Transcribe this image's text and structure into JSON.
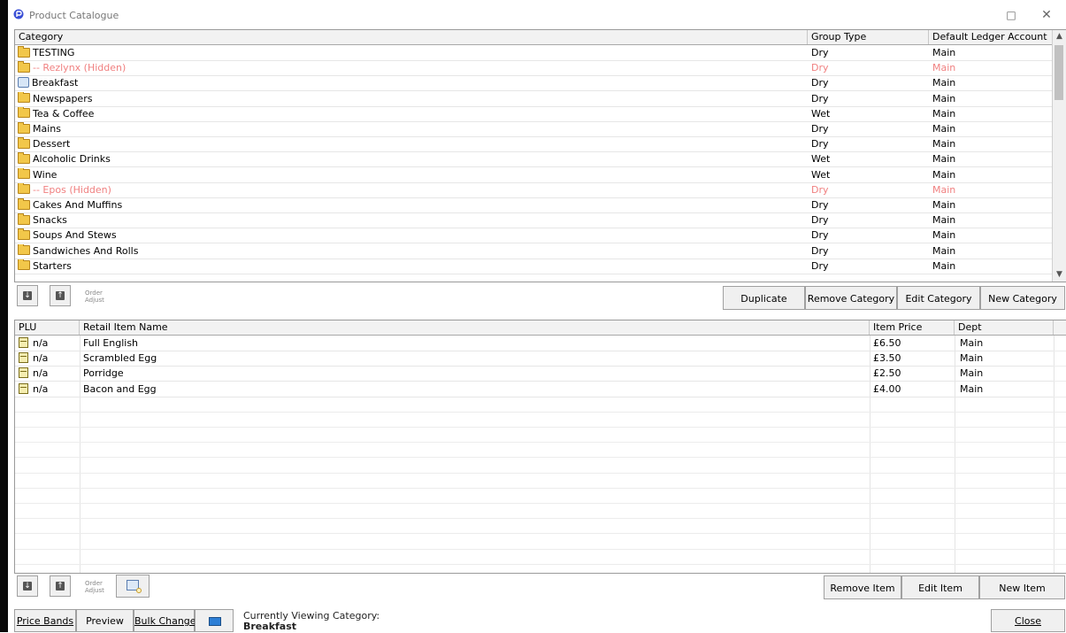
{
  "window": {
    "title": "Product Catalogue",
    "maximize_glyph": "□",
    "close_glyph": "✕"
  },
  "categories": {
    "headers": {
      "category": "Category",
      "group_type": "Group Type",
      "ledger": "Default Ledger Account"
    },
    "rows": [
      {
        "name": "TESTING",
        "group": "Dry",
        "ledger": "Main",
        "icon": "folder-icon",
        "hidden": false
      },
      {
        "name": "-- Rezlynx (Hidden)",
        "group": "Dry",
        "ledger": "Main",
        "icon": "folder-icon",
        "hidden": true
      },
      {
        "name": "Breakfast",
        "group": "Dry",
        "ledger": "Main",
        "icon": "menu-icon",
        "hidden": false
      },
      {
        "name": "Newspapers",
        "group": "Dry",
        "ledger": "Main",
        "icon": "folder-icon",
        "hidden": false
      },
      {
        "name": "Tea & Coffee",
        "group": "Wet",
        "ledger": "Main",
        "icon": "folder-icon",
        "hidden": false
      },
      {
        "name": "Mains",
        "group": "Dry",
        "ledger": "Main",
        "icon": "folder-icon",
        "hidden": false
      },
      {
        "name": "Dessert",
        "group": "Dry",
        "ledger": "Main",
        "icon": "folder-icon",
        "hidden": false
      },
      {
        "name": "Alcoholic Drinks",
        "group": "Wet",
        "ledger": "Main",
        "icon": "folder-icon",
        "hidden": false
      },
      {
        "name": "Wine",
        "group": "Wet",
        "ledger": "Main",
        "icon": "folder-icon",
        "hidden": false
      },
      {
        "name": "-- Epos (Hidden)",
        "group": "Dry",
        "ledger": "Main",
        "icon": "folder-icon",
        "hidden": true
      },
      {
        "name": "Cakes And Muffins",
        "group": "Dry",
        "ledger": "Main",
        "icon": "folder-icon",
        "hidden": false
      },
      {
        "name": "Snacks",
        "group": "Dry",
        "ledger": "Main",
        "icon": "folder-icon",
        "hidden": false
      },
      {
        "name": "Soups And Stews",
        "group": "Dry",
        "ledger": "Main",
        "icon": "folder-icon",
        "hidden": false
      },
      {
        "name": "Sandwiches And Rolls",
        "group": "Dry",
        "ledger": "Main",
        "icon": "folder-icon",
        "hidden": false
      },
      {
        "name": "Starters",
        "group": "Dry",
        "ledger": "Main",
        "icon": "folder-icon",
        "hidden": false
      }
    ],
    "order_label_1": "Order",
    "order_label_2": "Adjust",
    "move_down_glyph": "↓",
    "move_up_glyph": "↑",
    "buttons": {
      "duplicate": "Duplicate",
      "remove": "Remove Category",
      "edit": "Edit Category",
      "new": "New Category"
    },
    "scroll_up_glyph": "▲",
    "scroll_down_glyph": "▼"
  },
  "items": {
    "headers": {
      "plu": "PLU",
      "name": "Retail Item Name",
      "price": "Item Price",
      "dept": "Dept"
    },
    "rows": [
      {
        "plu": "n/a",
        "name": "Full English",
        "price": "£6.50",
        "dept": "Main"
      },
      {
        "plu": "n/a",
        "name": "Scrambled Egg",
        "price": "£3.50",
        "dept": "Main"
      },
      {
        "plu": "n/a",
        "name": "Porridge",
        "price": "£2.50",
        "dept": "Main"
      },
      {
        "plu": "n/a",
        "name": "Bacon and Egg",
        "price": "£4.00",
        "dept": "Main"
      }
    ],
    "order_label_1": "Order",
    "order_label_2": "Adjust",
    "move_down_glyph": "↓",
    "move_up_glyph": "↑",
    "buttons": {
      "remove": "Remove Item",
      "edit": "Edit Item",
      "new": "New Item"
    }
  },
  "footer": {
    "price_bands": "Price Bands",
    "preview": "Preview",
    "bulk_change": "Bulk Change",
    "status_label": "Currently Viewing Category:",
    "status_value": "Breakfast",
    "close": "Close"
  },
  "colors": {
    "hidden_text": "#f08080",
    "folder": "#f2c74a"
  }
}
